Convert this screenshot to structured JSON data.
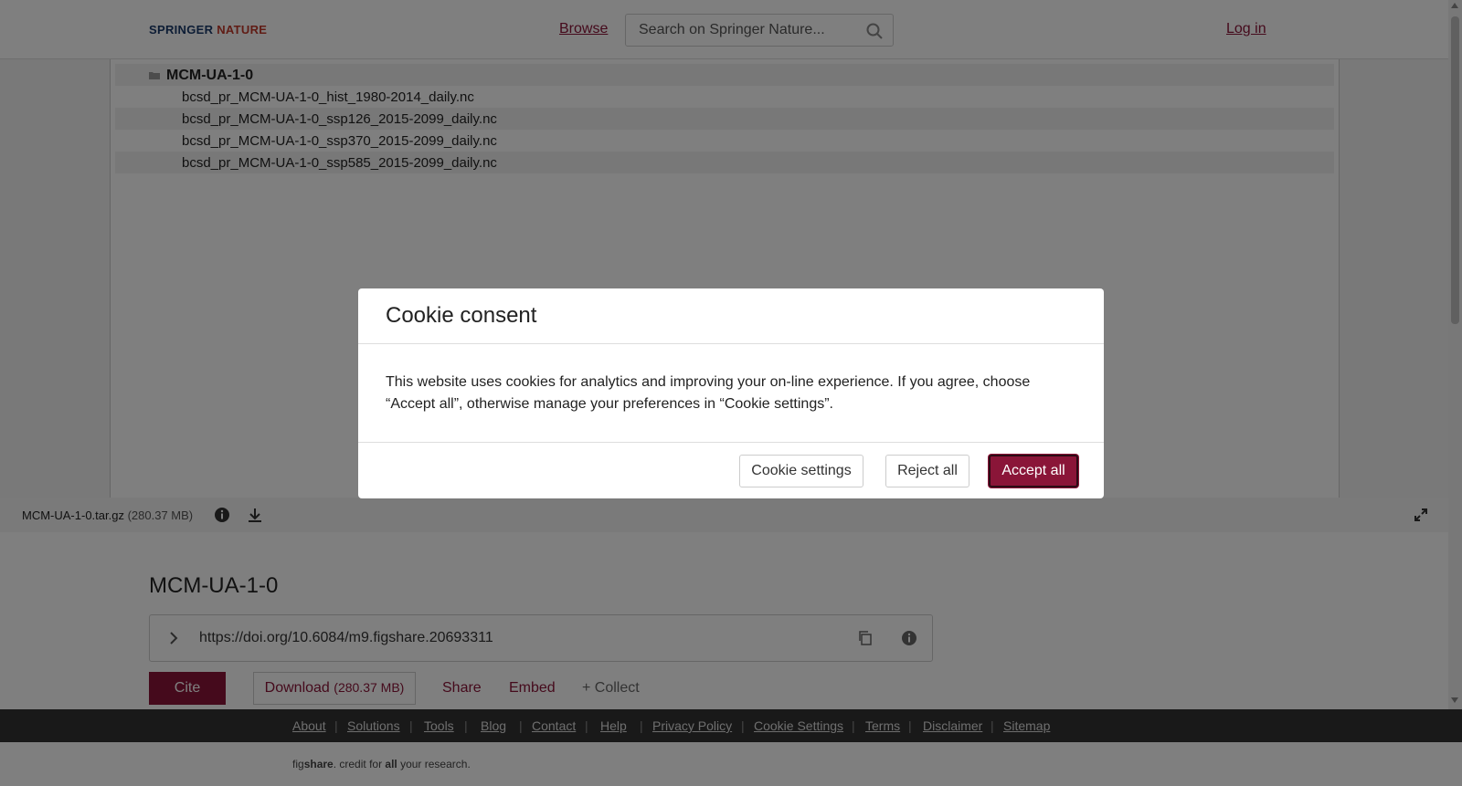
{
  "header": {
    "logo_part1": "SPRINGER",
    "logo_part2": "NATURE",
    "browse_label": "Browse",
    "search_placeholder": "Search on Springer Nature...",
    "login_label": "Log in"
  },
  "viewer": {
    "folder": "MCM-UA-1-0",
    "files": [
      "bcsd_pr_MCM-UA-1-0_hist_1980-2014_daily.nc",
      "bcsd_pr_MCM-UA-1-0_ssp126_2015-2099_daily.nc",
      "bcsd_pr_MCM-UA-1-0_ssp370_2015-2099_daily.nc",
      "bcsd_pr_MCM-UA-1-0_ssp585_2015-2099_daily.nc"
    ],
    "file_name": "MCM-UA-1-0.tar.gz",
    "file_size": "(280.37 MB)"
  },
  "item": {
    "title": "MCM-UA-1-0",
    "doi": "https://doi.org/10.6084/m9.figshare.20693311",
    "cite_label": "Cite",
    "download_label": "Download",
    "download_size": "(280.37 MB)",
    "share_label": "Share",
    "embed_label": "Embed",
    "collect_label": "+ Collect"
  },
  "footer": {
    "links": [
      "About",
      "Solutions",
      "Tools",
      "Blog",
      "Contact",
      "Help",
      "Privacy Policy",
      "Cookie Settings",
      "Terms",
      "Disclaimer",
      "Sitemap"
    ],
    "credit_prefix": "fig",
    "credit_bold1": "share",
    "credit_mid": ". credit for ",
    "credit_bold2": "all",
    "credit_suffix": " your research."
  },
  "cookie_modal": {
    "title": "Cookie consent",
    "body": "This website uses cookies for analytics and improving your on-line experience. If you agree, choose “Accept all”, otherwise manage your preferences in “Cookie settings”.",
    "settings_label": "Cookie settings",
    "reject_label": "Reject all",
    "accept_label": "Accept all"
  },
  "colors": {
    "brand": "#8a1538",
    "overlay": "rgba(0,0,0,0.5)"
  }
}
